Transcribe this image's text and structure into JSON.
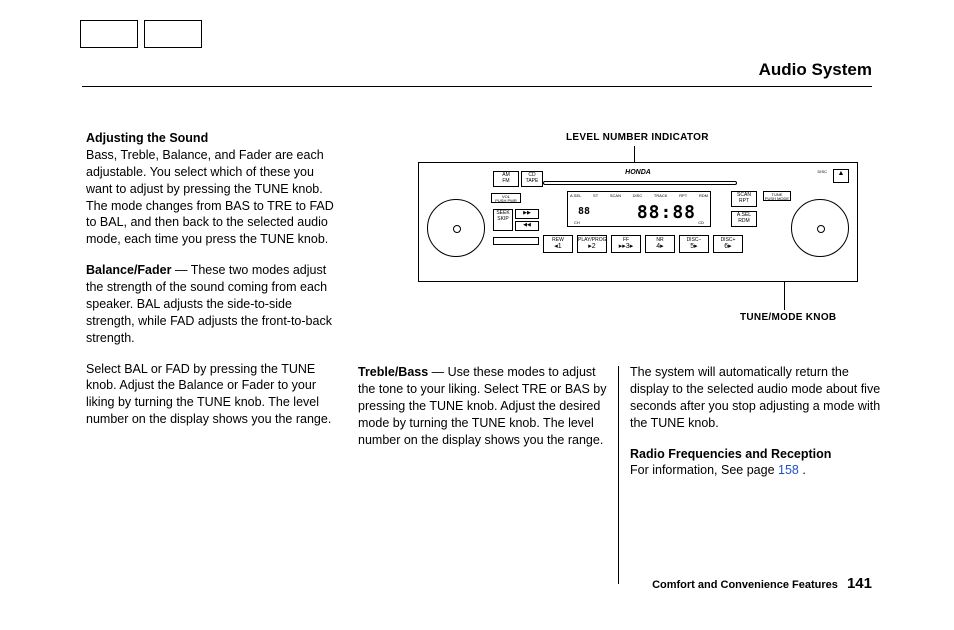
{
  "header": {
    "title": "Audio System"
  },
  "figure": {
    "indicator_label": "LEVEL NUMBER INDICATOR",
    "knob_label": "TUNE/MODE  KNOB",
    "brand": "HONDA",
    "eject_label": "DISC",
    "digits": "88:88",
    "digits_small": "88",
    "lcd_ch": "CH",
    "lcd_cd": "CD",
    "buttons": {
      "am_fm": "AM\nFM",
      "cd_tape": "CD\nTAPE",
      "vol_pwr": "VOL\nPUSH PWR",
      "seek_skip": "SEEK\nSKIP",
      "fwd": "▶▶",
      "rew": "◀◀",
      "scan_rpt": "SCAN\nRPT",
      "asel_rdm": "A.SEL\nRDM",
      "tune_mode": "TUNE\nPUSH MODE",
      "lcd_top_items": [
        "A.SEL",
        "ST",
        "SCAN",
        "DISC",
        "TRACK",
        "RPT",
        "RDM"
      ]
    },
    "presets": [
      {
        "top": "REW",
        "num": "◂1"
      },
      {
        "top": "PLAY/PROG",
        "num": "▸2"
      },
      {
        "top": "FF",
        "num": "▸▸ 3▸"
      },
      {
        "top": "NR",
        "num": "4▸"
      },
      {
        "top": "DISC−",
        "num": "5▸"
      },
      {
        "top": "DISC+",
        "num": "6▸"
      }
    ]
  },
  "col1": {
    "h1": "Adjusting the Sound",
    "p1": "Bass, Treble, Balance, and Fader are each adjustable. You select which of these you want to adjust by pressing the TUNE knob. The mode changes from BAS to TRE to FAD to BAL, and then back to the selected audio mode, each time you press the TUNE knob.",
    "h2": "Balance/Fader",
    "p2": " — These two modes adjust the strength of the sound coming from each speaker. BAL adjusts the side-to-side strength, while FAD adjusts the front-to-back strength.",
    "p3": "Select BAL or FAD by pressing the TUNE knob. Adjust the Balance or Fader to your liking by turning the TUNE knob. The level number on the display shows you the range."
  },
  "col2": {
    "h1": "Treble/Bass",
    "p1": " — Use these modes to adjust the tone to your liking. Select TRE or BAS by pressing the TUNE knob. Adjust the desired mode by turning the TUNE knob. The level number on the display shows you the range."
  },
  "col3": {
    "p1": "The system will automatically return the display to the selected audio mode about five seconds after you stop adjusting a mode with the TUNE knob.",
    "h1": "Radio Frequencies and Reception",
    "p2_a": "For information, See page ",
    "p2_link": "158",
    "p2_b": " ."
  },
  "footer": {
    "section": "Comfort and Convenience Features",
    "page": "141"
  }
}
